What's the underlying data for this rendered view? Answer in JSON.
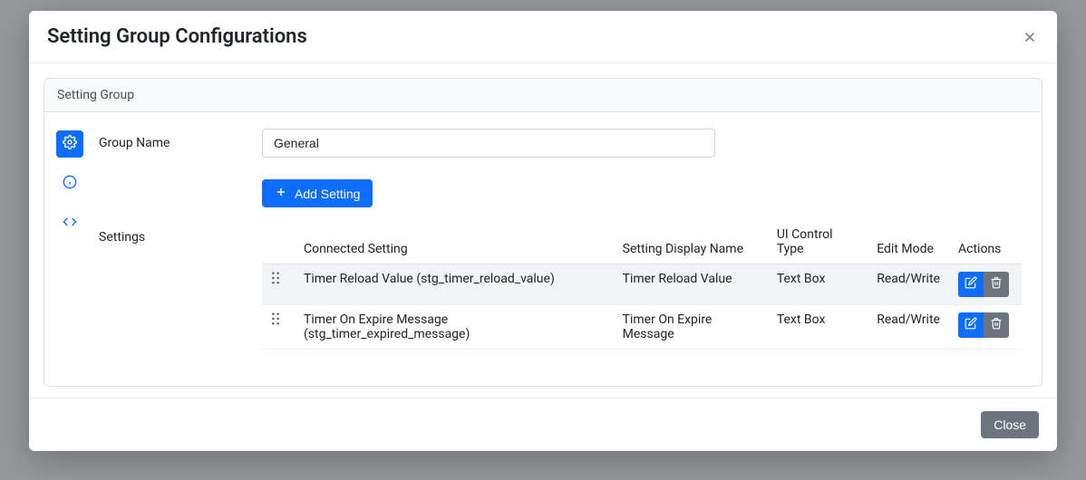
{
  "modal": {
    "title": "Setting Group Configurations",
    "close_label": "Close"
  },
  "panel": {
    "header": "Setting Group"
  },
  "side_tabs": [
    {
      "name": "gear-icon",
      "active": true
    },
    {
      "name": "info-icon",
      "active": false
    },
    {
      "name": "code-icon",
      "active": false
    }
  ],
  "form": {
    "group_name_label": "Group Name",
    "group_name_value": "General",
    "settings_label": "Settings"
  },
  "add_setting_button": "Add Setting",
  "table": {
    "headers": {
      "connected_setting": "Connected Setting",
      "display_name": "Setting Display Name",
      "ui_control": "UI Control Type",
      "edit_mode": "Edit Mode",
      "actions": "Actions"
    },
    "rows": [
      {
        "connected_setting": "Timer Reload Value (stg_timer_reload_value)",
        "display_name": "Timer Reload Value",
        "ui_control": "Text Box",
        "edit_mode": "Read/Write"
      },
      {
        "connected_setting": "Timer On Expire Message (stg_timer_expired_message)",
        "display_name": "Timer On Expire Message",
        "ui_control": "Text Box",
        "edit_mode": "Read/Write"
      }
    ]
  }
}
